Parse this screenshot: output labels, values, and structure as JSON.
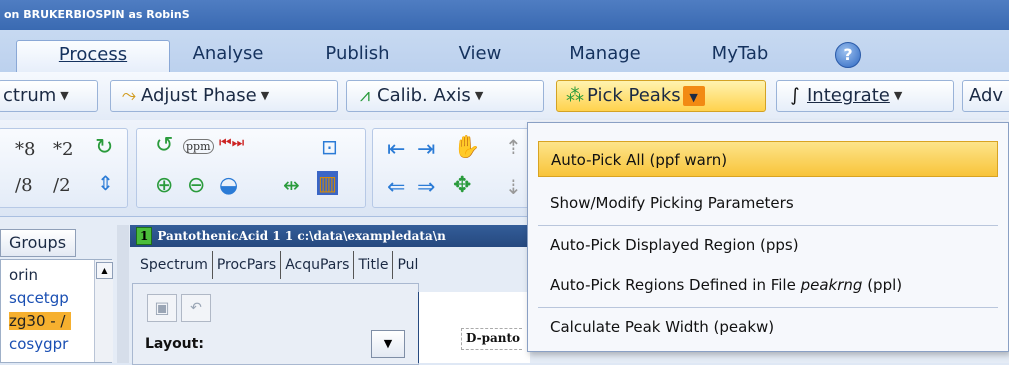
{
  "window": {
    "title": "on BRUKERBIOSPIN as RobinS"
  },
  "ribbon": {
    "tabs": [
      {
        "label": "Process"
      },
      {
        "label": "Analyse"
      },
      {
        "label": "Publish"
      },
      {
        "label": "View"
      },
      {
        "label": "Manage"
      },
      {
        "label": "MyTab"
      }
    ],
    "help_glyph": "?"
  },
  "toolbar": {
    "spectrum_label": "ctrum",
    "adjust_phase_label": "Adjust Phase",
    "calib_axis_label": "Calib. Axis",
    "pick_peaks_label": "Pick Peaks",
    "integrate_label": "Integrate",
    "adv_label": "Adv"
  },
  "tools": {
    "mult8": "*8",
    "mult2": "*2",
    "div8": "/8",
    "div2": "/2",
    "ppm": "ppm"
  },
  "left_panel": {
    "groups_label": "Groups",
    "items": [
      "orin",
      "sqcetgp",
      "zg30 - /",
      "cosygpr"
    ]
  },
  "document": {
    "number": "1",
    "title": "PantothenicAcid  1 1  c:\\data\\exampledata\\n",
    "subtabs": [
      "Spectrum",
      "ProcPars",
      "AcquPars",
      "Title",
      "Pul"
    ],
    "layout_label": "Layout:",
    "plot_label": "D-panto"
  },
  "pick_peaks_menu": {
    "items": [
      {
        "label": "Auto-Pick All (ppf warn)"
      },
      {
        "label": "Show/Modify Picking Parameters"
      },
      {
        "label": "Auto-Pick Displayed Region (pps)"
      },
      {
        "label_pre": "Auto-Pick Regions Defined in File ",
        "label_em": "peakrng",
        "label_post": " (ppl)"
      },
      {
        "label": "Calculate Peak Width (peakw)"
      }
    ]
  },
  "colors": {
    "accent": "#f8c43a",
    "titlebar": "#3a6ab2",
    "active_button": "#ffd24d"
  }
}
